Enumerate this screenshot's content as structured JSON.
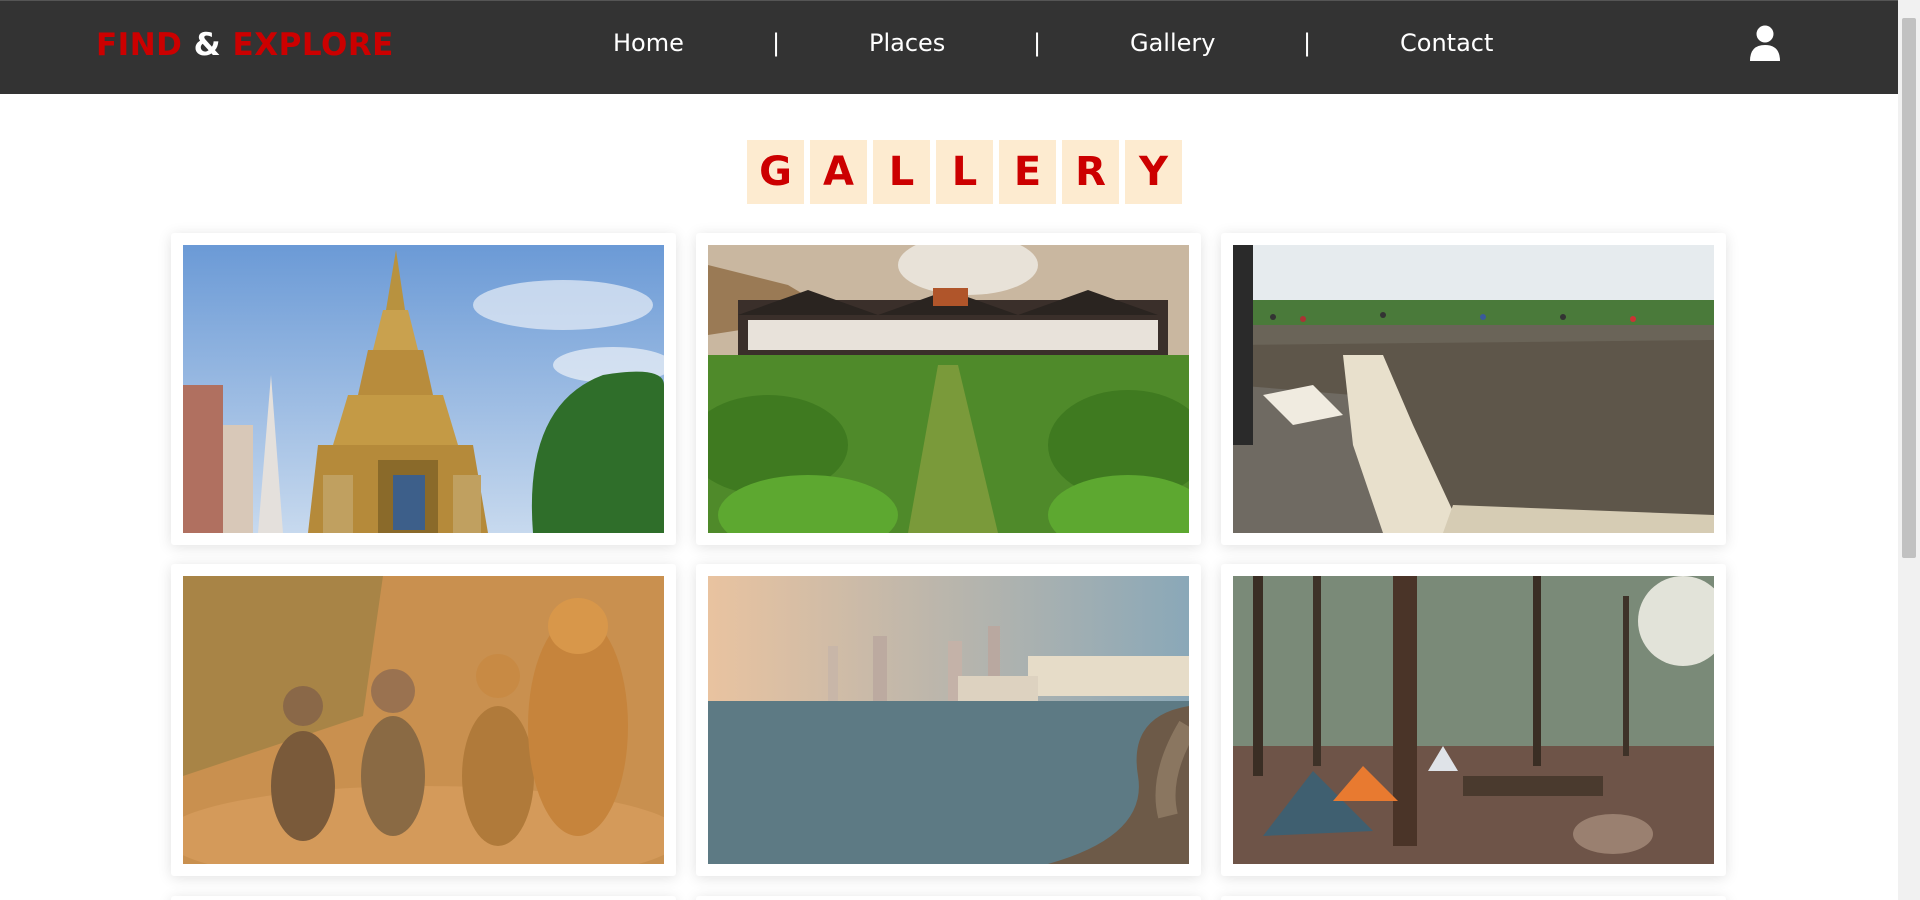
{
  "header": {
    "logo_part1": "FIND",
    "logo_amp": " & ",
    "logo_part2": "EXPLORE",
    "nav": [
      "Home",
      "Places",
      "Gallery",
      "Contact"
    ],
    "separator": "|",
    "user_icon": "user-icon"
  },
  "gallery": {
    "title_letters": [
      "G",
      "A",
      "L",
      "L",
      "E",
      "R",
      "Y"
    ]
  },
  "colors": {
    "navbar": "#333333",
    "brand_red": "#cc0000",
    "title_tile": "#fdebd0"
  }
}
